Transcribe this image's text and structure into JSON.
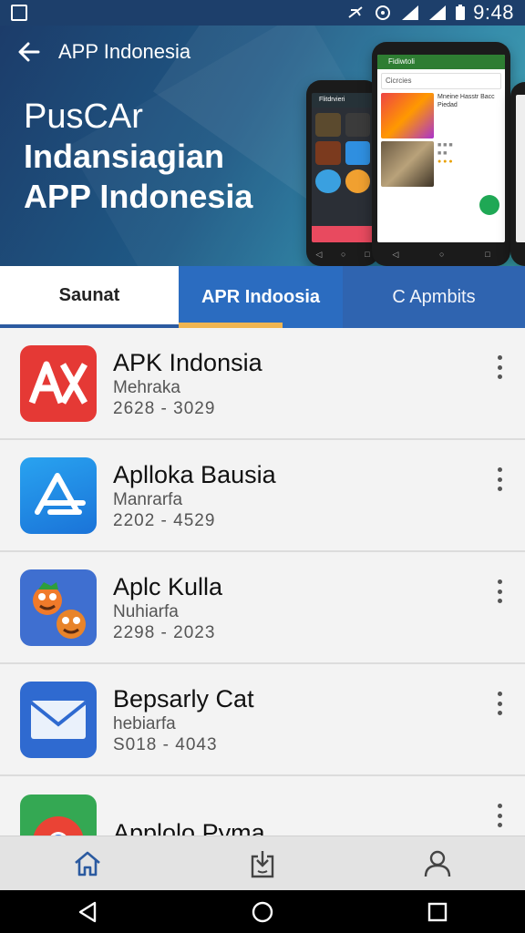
{
  "status_bar": {
    "time": "9:48"
  },
  "header": {
    "title": "APP Indonesia",
    "hero_line1": "PusCAr",
    "hero_line2": "Indansiagian",
    "hero_line3": "APP Indonesia"
  },
  "phone_mock": {
    "front_bar": "Fidiwtoli",
    "front_search": "Cicrcies",
    "card1_text": "Mneine Hasstr Bacc Piedad",
    "back_bar": "Flitdrvieri"
  },
  "tabs": [
    {
      "label": "Saunat"
    },
    {
      "label": "APR Indoosia"
    },
    {
      "label": "C Apmbits"
    }
  ],
  "apps": [
    {
      "title": "APK Indonsia",
      "subtitle": "Mehraka",
      "nums": "2628 - 3029",
      "icon": "apk-logo-icon",
      "color": "#e53935"
    },
    {
      "title": "Aplloka Bausia",
      "subtitle": "Manrarfa",
      "nums": "2202 - 4529",
      "icon": "app-store-icon",
      "color": "#1e88e5"
    },
    {
      "title": "Aplc Kulla",
      "subtitle": "Nuhiarfa",
      "nums": "2298 - 2023",
      "icon": "cartoon-game-icon",
      "color": "#3f6fd0"
    },
    {
      "title": "Bepsarly Cat",
      "subtitle": "hebiarfa",
      "nums": "S018 - 4043",
      "icon": "mail-icon",
      "color": "#2f6ad0"
    },
    {
      "title": "Applolo Pyma",
      "subtitle": "",
      "nums": "",
      "icon": "chrome-icon",
      "color": "#34a853"
    }
  ],
  "bottom_nav": [
    {
      "icon": "home-icon"
    },
    {
      "icon": "download-icon"
    },
    {
      "icon": "profile-icon"
    }
  ]
}
